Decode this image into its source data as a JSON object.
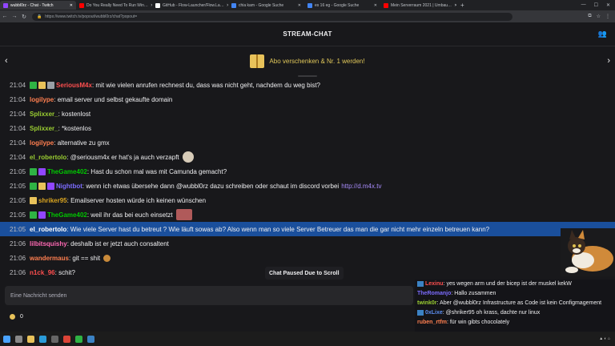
{
  "browser": {
    "tabs": [
      {
        "title": "wubbl0rz - Chat - Twitch",
        "color": "#9146ff"
      },
      {
        "title": "Do You Really Need To Run Win…",
        "color": "#ff0000"
      },
      {
        "title": "GitHub - Flow-Launcher/Flow.La…",
        "color": "#ffffff"
      },
      {
        "title": "chia kam - Google Suche",
        "color": "#4285f4"
      },
      {
        "title": "es 16 eg - Google Suche",
        "color": "#4285f4"
      },
      {
        "title": "Mein Serverraum 2021 | Umbau…",
        "color": "#ff0000"
      }
    ],
    "new_tab": "+",
    "url": "https://www.twitch.tv/popout/wubbl0rz/chat?popout="
  },
  "header": {
    "title": "STREAM-CHAT"
  },
  "banner": {
    "text": "Abo verschenken & Nr. 1 werden!"
  },
  "messages": [
    {
      "time": "21:04",
      "badges": [
        "#2fb344",
        "#e8c25a",
        "#9aa0a6"
      ],
      "user": "SeriousM4x",
      "color": "#ff4f4f",
      "text": ": mit wie vielen anrufen rechnest du, dass was nicht geht, nachdem du weg bist?"
    },
    {
      "time": "21:04",
      "badges": [],
      "user": "logilype",
      "color": "#ff7f50",
      "text": ": email server und selbst gekaufte domain"
    },
    {
      "time": "21:04",
      "badges": [],
      "user": "Splixxer_",
      "color": "#9acd32",
      "text": ": kostenlost"
    },
    {
      "time": "21:04",
      "badges": [],
      "user": "Splixxer_",
      "color": "#9acd32",
      "text": ": *kostenlos"
    },
    {
      "time": "21:04",
      "badges": [],
      "user": "logilype",
      "color": "#ff7f50",
      "text": ": alternative zu gmx"
    },
    {
      "time": "21:04",
      "badges": [],
      "user": "el_robertolo",
      "color": "#9acd32",
      "text": ": @seriousm4x er hat's ja auch verzapft"
    },
    {
      "time": "21:05",
      "badges": [
        "#2fb344",
        "#9146ff"
      ],
      "user": "TheGame402",
      "color": "#00c800",
      "text": ": Hast du schon mal was mit Camunda gemacht?"
    },
    {
      "time": "21:05",
      "badges": [
        "#2fb344",
        "#e8c25a",
        "#9146ff"
      ],
      "user": "Nightbot",
      "color": "#7c6cff",
      "text": ": wenn ich etwas übersehe dann @wubbl0rz dazu schreiben oder schaut im discord vorbei",
      "link": "http://d.m4x.tv"
    },
    {
      "time": "21:05",
      "badges": [
        "#e8c25a"
      ],
      "user": "shriker95",
      "color": "#daa520",
      "text": ": Emailserver hosten würde ich keinen wünschen"
    },
    {
      "time": "21:05",
      "badges": [
        "#2fb344",
        "#9146ff"
      ],
      "user": "TheGame402",
      "color": "#00c800",
      "text": ": weil ihr das bei euch einsetzt"
    },
    {
      "time": "21:05",
      "badges": [],
      "user": "el_robertolo",
      "color": "#ffffff",
      "text": ": Wie viele Server hast du betreut ? Wie läuft sowas ab? Also wenn man so viele Server Betreuer das man die gar nicht mehr einzeln betreuen kann?"
    },
    {
      "time": "21:06",
      "badges": [],
      "user": "lilbitsquishy",
      "color": "#ff69b4",
      "text": ": deshalb ist er jetzt auch consaltent"
    },
    {
      "time": "21:06",
      "badges": [],
      "user": "wandermaus",
      "color": "#ff7f50",
      "text": ": git == shit"
    },
    {
      "time": "21:06",
      "badges": [],
      "user": "n1ck_96",
      "color": "#ff4f4f",
      "text": ": schit?"
    }
  ],
  "paused_label": "Chat Paused Due to Scroll",
  "input": {
    "placeholder": "Eine Nachricht senden"
  },
  "points": {
    "value": "0"
  },
  "overlay": [
    {
      "user": "Lexinu",
      "color": "#ff4f4f",
      "text": ": yes wegen arm und der bicep ist der muskel kekW",
      "badge": true
    },
    {
      "user": "TheRomanjo",
      "color": "#7c6cff",
      "text": ": Hallo zusammen",
      "badge": false
    },
    {
      "user": "twink0r",
      "color": "#9acd32",
      "text": ": Aber @wubbl0rz Infrastructure as Code ist kein Configmagement",
      "badge": false
    },
    {
      "user": "0xLixe",
      "color": "#5b8def",
      "text": ": @shriker95 oh krass, dachte nur linux",
      "badge": true
    },
    {
      "user": "ruben_rtfm",
      "color": "#ff7f50",
      "text": ": für win gibts chocolately",
      "badge": false
    }
  ]
}
